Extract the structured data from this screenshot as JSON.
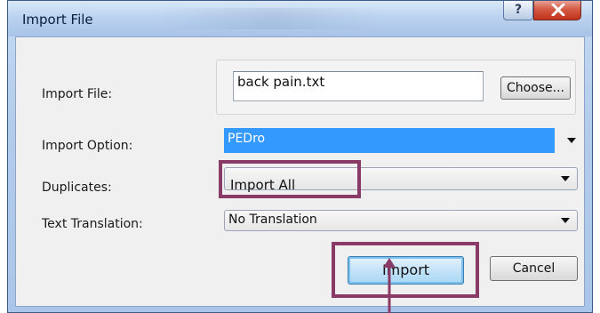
{
  "window": {
    "title": "Import File",
    "help_label": "?",
    "colors": {
      "title_bar": "#b9d1ef",
      "close_button": "#c9432c",
      "highlight": "#8a3a66",
      "selection": "#3399ff"
    }
  },
  "form": {
    "import_file": {
      "label": "Import File:",
      "value": "back pain.txt",
      "choose_label": "Choose..."
    },
    "import_option": {
      "label": "Import Option:",
      "value": "PEDro"
    },
    "duplicates": {
      "label": "Duplicates:",
      "value": "Import All"
    },
    "text_translation": {
      "label": "Text Translation:",
      "value": "No Translation"
    }
  },
  "buttons": {
    "import_label": "Import",
    "cancel_label": "Cancel"
  }
}
